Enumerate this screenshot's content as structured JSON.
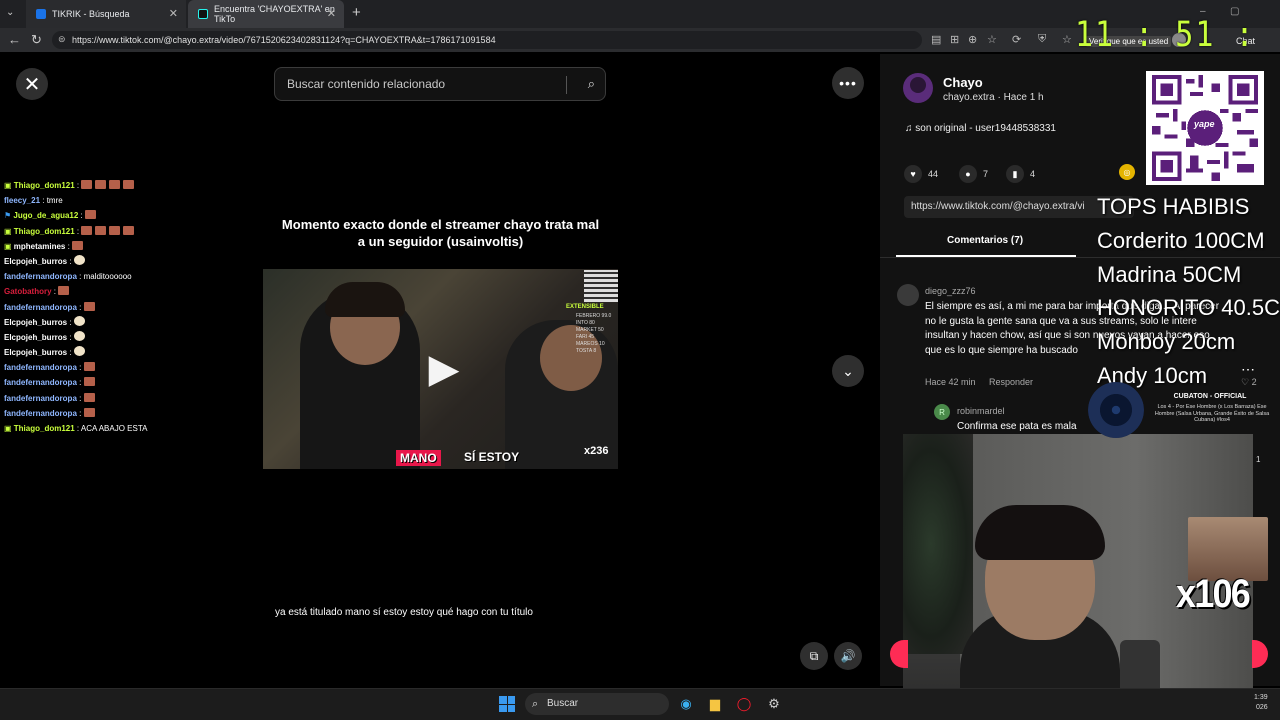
{
  "browser": {
    "tabs": [
      {
        "label": "TIKRIK - Búsqueda"
      },
      {
        "label": "Encuentra 'CHAYOEXTRA' en TikTo"
      }
    ],
    "url": "https://www.tiktok.com/@chayo.extra/video/7671520623402831124?q=CHAYOEXTRA&t=1786171091584",
    "verify_label": "Verifique que es usted",
    "chat_label": "Chat"
  },
  "clock": "11 : 51 : 47",
  "search": {
    "placeholder": "Buscar contenido relacionado"
  },
  "video": {
    "title": "Momento exacto donde el streamer chayo trata mal a un seguidor (usainvoltis)",
    "subtitle_highlight": "MANO",
    "subtitle_rest": "SÍ ESTOY",
    "caption": "ya está titulado mano sí estoy estoy qué hago con tu título",
    "inner_overlay": {
      "extensible": "EXTENSIBLE",
      "list": "FEBRERO 99.0\nINTO 80\nMARKET 50\nFARI 45\nMAREOS 10\nTOSTA 8",
      "multiplier": "x236"
    }
  },
  "chat": [
    {
      "user": "Thiago_dom121",
      "color": "#c9ff3c",
      "text": "",
      "emotes": 4
    },
    {
      "user": "fleecy_21",
      "color": "#8fb7ff",
      "text": "tmre",
      "emotes": 0
    },
    {
      "user": "Jugo_de_agua12",
      "color": "#c9ff3c",
      "text": "",
      "emotes": 1
    },
    {
      "user": "Thiago_dom121",
      "color": "#c9ff3c",
      "text": "",
      "emotes": 4
    },
    {
      "user": "mphetamines",
      "color": "#ffffff",
      "text": "",
      "emotes": 1
    },
    {
      "user": "Elcpojeh_burros",
      "color": "#ffffff",
      "text": "",
      "emotes": 0,
      "face": true
    },
    {
      "user": "fandefernandoropa",
      "color": "#8fb7ff",
      "text": "malditoooooo",
      "emotes": 0
    },
    {
      "user": "Gatobathory",
      "color": "#d81e3c",
      "text": "",
      "emotes": 1
    },
    {
      "user": "fandefernandoropa",
      "color": "#8fb7ff",
      "text": "",
      "emotes": 1
    },
    {
      "user": "Elcpojeh_burros",
      "color": "#ffffff",
      "text": "",
      "emotes": 0,
      "face": true
    },
    {
      "user": "Elcpojeh_burros",
      "color": "#ffffff",
      "text": "",
      "emotes": 0,
      "face": true
    },
    {
      "user": "Elcpojeh_burros",
      "color": "#ffffff",
      "text": "",
      "emotes": 0,
      "face": true
    },
    {
      "user": "fandefernandoropa",
      "color": "#8fb7ff",
      "text": "",
      "emotes": 1
    },
    {
      "user": "fandefernandoropa",
      "color": "#8fb7ff",
      "text": "",
      "emotes": 1
    },
    {
      "user": "fandefernandoropa",
      "color": "#8fb7ff",
      "text": "",
      "emotes": 1
    },
    {
      "user": "fandefernandoropa",
      "color": "#8fb7ff",
      "text": "",
      "emotes": 1
    },
    {
      "user": "Thiago_dom121",
      "color": "#c9ff3c",
      "text": "ACA ABAJO ESTA",
      "emotes": 0
    }
  ],
  "post": {
    "author": "Chayo",
    "handle_time": "chayo.extra · Hace 1 h",
    "sound": "son original - user19448538331",
    "likes": "44",
    "comments": "7",
    "saves": "4",
    "share_url": "https://www.tiktok.com/@chayo.extra/vi"
  },
  "comments_tab": {
    "label": "Comentarios (7)"
  },
  "comments": [
    {
      "user": "diego_zzz76",
      "text": "El siempre es así, a mi me para bar importa que diga.... Al parecer no le gusta la gente sana que va a sus streams, solo le intere insultan y hacen chow, así que si son nuevos vayan a hacer eso que es lo que siempre ha buscado",
      "time": "Hace 42 min",
      "reply": "Responder",
      "likes": "2"
    },
    {
      "user": "robinmardel",
      "avatar_letter": "R",
      "text": "Confirma ese pata es mala"
    }
  ],
  "overlay": {
    "tops": [
      "TOPS HABIBIS",
      "Corderito 100CM",
      "Madrina 50CM",
      "HONORITO 40.5C",
      "Monboy 20cm",
      "Andy 10cm"
    ],
    "qr_label": "yape",
    "music_title": "CUBATON - OFFICIAL",
    "music_sub": "Los 4 - Por Ese Hombre (x Los Barraza) Ese Hombre (Salsa Urbana, Grande Éxito de Salsa Cubana) #los4",
    "multiplier": "x106",
    "side_number": "1"
  },
  "taskbar": {
    "search": "Buscar",
    "time": "1:39",
    "date": "026"
  },
  "colors": {
    "tiktok_red": "#fe2c55",
    "clock": "#c9ff3c",
    "panel": "#121212"
  }
}
